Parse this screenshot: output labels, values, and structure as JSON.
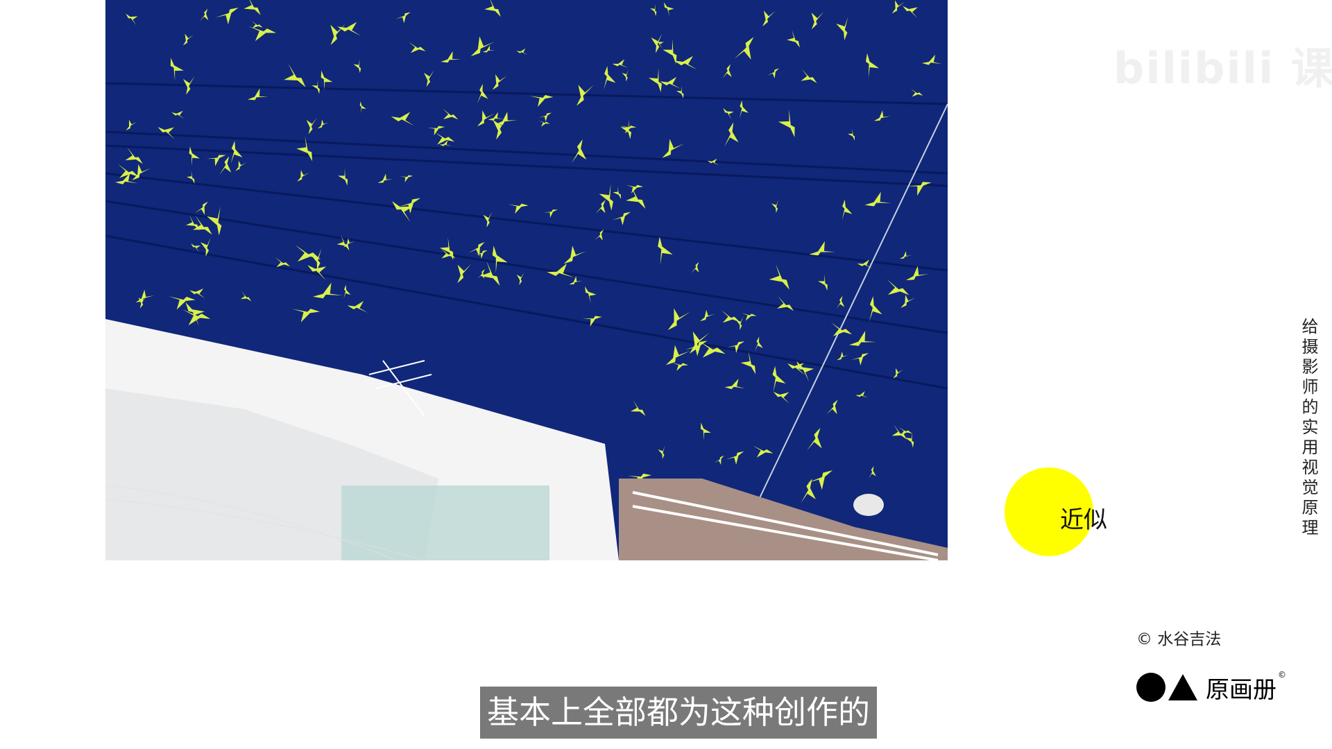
{
  "photo": {
    "description_icon": "parakeets-flock-photo",
    "sky_color": "#10277a",
    "bird_color": "#d9f04a"
  },
  "watermark": {
    "text": "bilibili 课堂"
  },
  "marker": {
    "color": "#ffff00",
    "label": "近似"
  },
  "series_title": "给摄影师的实用视觉原理",
  "credit": "© 水谷吉法",
  "logo": {
    "text": "原画册",
    "mark": "©"
  },
  "subtitle": "基本上全部都为这种创作的"
}
